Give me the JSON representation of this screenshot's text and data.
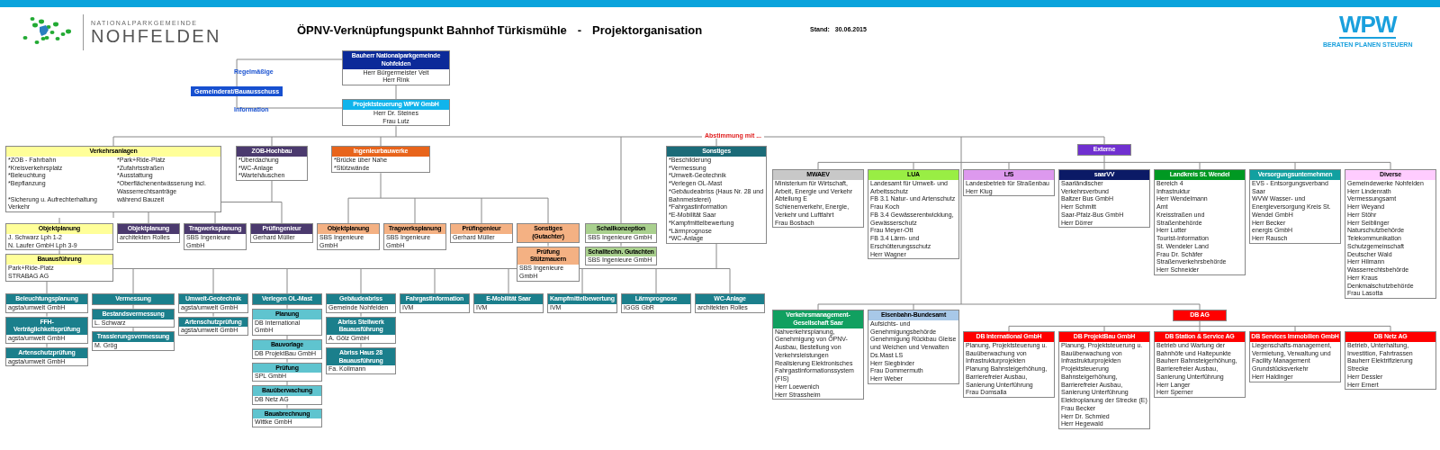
{
  "header": {
    "logo_top": "NATIONALPARKGEMEINDE",
    "logo_name": "NOHFELDEN",
    "title": "ÖPNV-Verknüpfungspunkt Bahnhof Türkismühle",
    "separator": "-",
    "subtitle": "Projektorganisation",
    "stand_label": "Stand:",
    "stand_date": "30.06.2015",
    "wpw": "WPW",
    "wpw_tagline": "BERATEN PLANEN STEUERN"
  },
  "top": {
    "bauherr": {
      "title": "Bauherr Nationalparkgemeinde Nohfelden",
      "lines": [
        "Herr Bürgermeister Veit",
        "Herr Rink"
      ]
    },
    "projektsteuerung": {
      "title": "Projektsteuerung WPW GmbH",
      "lines": [
        "Herr Dr. Steines",
        "Frau Lutz"
      ]
    },
    "gremium": "Gemeinderat/Bauausschuss",
    "info_top": "Regelmäßige",
    "info_bottom": "Information"
  },
  "abstimmung": "Abstimmung mit ...",
  "nodes": [
    {
      "title": "Verkehrsanlagen",
      "color": "#ffff99",
      "lines": [
        "*ZOB - Fahrbahn",
        "*Park+Ride-Platz",
        "*Kreisverkehrsplatz",
        "*Zufahrtsstraßen",
        "*Beleuchtung",
        "*Ausstattung",
        "*Bepflanzung",
        "*Oberflächenentwässerung incl. Wasserrechtsanträge",
        "*Sicherung u. Aufrechterhaltung Verkehr",
        "während Bauzeit"
      ]
    },
    {
      "title": "ZOB-Hochbau",
      "color": "#4b3a6e",
      "lines": [
        "*Überdachung",
        "*WC-Anlage",
        "*Wartehäuschen"
      ]
    },
    {
      "title": "Ingenieurbauwerke",
      "color": "#e8641b",
      "lines": [
        "*Brücke über Nahe",
        "*Stützwände"
      ]
    },
    {
      "title": "Sonstiges",
      "color": "#1b6b78",
      "lines": [
        "*Beschilderung",
        "*Vermessung",
        "*Umwelt-Geotechnik",
        "*Verlegen OL-Mast",
        "*Gebäudeabriss (Haus Nr. 28 und Bahnmeisterei)",
        "*Fahrgastinformation",
        "*E-Mobilität Saar",
        "*Kampfmittelbewertung",
        "*Lärmprognose",
        "*WC-Anlage"
      ]
    },
    {
      "title": "Objektplanung",
      "color": "#ffff99",
      "lines": [
        "J. Schwarz Lph 1-2",
        "N. Laufer GmbH Lph 3-9"
      ]
    },
    {
      "title": "Bauausführung",
      "color": "#ffff99",
      "lines": [
        "Park+Ride-Platz",
        "STRABAG AG"
      ]
    },
    {
      "title": "Objektplanung",
      "color": "#4b3a6e",
      "lines": [
        "architekten Rolles"
      ]
    },
    {
      "title": "Tragwerksplanung",
      "color": "#4b3a6e",
      "lines": [
        "SBS Ingenieure GmbH"
      ]
    },
    {
      "title": "Prüfingenieur",
      "color": "#4b3a6e",
      "lines": [
        "Gerhard Müller"
      ]
    },
    {
      "title": "Objektplanung",
      "color": "#f4b183",
      "lines": [
        "SBS Ingenieure GmbH"
      ]
    },
    {
      "title": "Tragwerksplanung",
      "color": "#f4b183",
      "lines": [
        "SBS Ingenieure GmbH"
      ]
    },
    {
      "title": "Prüfingenieur",
      "color": "#f4b183",
      "lines": [
        "Gerhard Müller"
      ]
    },
    {
      "title": "Sonstiges (Gutachter)",
      "color": "#f4b183"
    },
    {
      "title": "Prüfung Stützmauern",
      "color": "#f4b183",
      "lines": [
        "SBS Ingenieure GmbH"
      ]
    },
    {
      "title": "Schallkonzeption",
      "color": "#a9d08e",
      "lines": [
        "SBS Ingenieure GmbH"
      ]
    },
    {
      "title": "Schalltechn. Gutachten",
      "color": "#a9d08e",
      "lines": [
        "SBS Ingenieure GmbH"
      ]
    },
    {
      "title": "Beleuchtungsplanung",
      "color": "#1b7f8c",
      "lines": [
        "agsta/umwelt GmbH"
      ]
    },
    {
      "title": "Vermessung",
      "color": "#1b7f8c"
    },
    {
      "title": "Umwelt-Geotechnik",
      "color": "#1b7f8c",
      "lines": [
        "agsta/umwelt GmbH"
      ]
    },
    {
      "title": "Verlegen OL-Mast",
      "color": "#1b7f8c"
    },
    {
      "title": "Gebäudeabriss",
      "color": "#1b7f8c",
      "lines": [
        "Gemeinde Nohfelden"
      ]
    },
    {
      "title": "Fahrgastinformation",
      "color": "#1b7f8c",
      "lines": [
        "IVM"
      ]
    },
    {
      "title": "E-Mobilität Saar",
      "color": "#1b7f8c",
      "lines": [
        "IVM"
      ]
    },
    {
      "title": "Kampfmittelbewertung",
      "color": "#1b7f8c",
      "lines": [
        "IVM"
      ]
    },
    {
      "title": "Lärmprognose",
      "color": "#1b7f8c",
      "lines": [
        "IGGS GbR"
      ]
    },
    {
      "title": "WC-Anlage",
      "color": "#1b7f8c",
      "lines": [
        "architekten Rolles"
      ]
    },
    {
      "title": "FFH-Verträglichkeitsprüfung",
      "color": "#1b7f8c",
      "lines": [
        "agsta/umwelt GmbH"
      ]
    },
    {
      "title": "Artenschutzprüfung",
      "color": "#1b7f8c",
      "lines": [
        "agsta/umwelt GmbH"
      ]
    },
    {
      "title": "Bestandsvermessung",
      "color": "#1b7f8c",
      "lines": [
        "L. Schwarz"
      ]
    },
    {
      "title": "Trassierungsvermessung",
      "color": "#1b7f8c",
      "lines": [
        "M. Grög"
      ]
    },
    {
      "title": "Artenschutzprüfung",
      "color": "#1b7f8c",
      "lines": [
        "agsta/umwelt GmbH"
      ]
    },
    {
      "title": "Planung",
      "color": "#5fc4cf",
      "lines": [
        "DB International GmbH"
      ]
    },
    {
      "title": "Bauvorlage",
      "color": "#5fc4cf",
      "lines": [
        "DB ProjektBau GmbH"
      ]
    },
    {
      "title": "Prüfung",
      "color": "#5fc4cf",
      "lines": [
        "SPL GmbH"
      ]
    },
    {
      "title": "Bauüberwachung",
      "color": "#5fc4cf",
      "lines": [
        "DB Netz AG"
      ]
    },
    {
      "title": "Bauabrechnung",
      "color": "#5fc4cf",
      "lines": [
        "Wittke GmbH"
      ]
    },
    {
      "title": "Abriss Stellwerk Bauausführung",
      "color": "#1b7f8c",
      "lines": [
        "A. Gölz GmbH"
      ]
    },
    {
      "title": "Abriss Haus 28 Bauausführung",
      "color": "#1b7f8c",
      "lines": [
        "Fa. Kollmann"
      ]
    },
    {
      "title": "Externe",
      "color": "#7030d0"
    },
    {
      "title": "DB AG",
      "color": "#ff0000"
    },
    {
      "title": "MWAEV",
      "color": "#c8c8c8",
      "lines": [
        "Ministerium für Wirtschaft, Arbeit, Energie und Verkehr",
        "Abteilung E",
        "Schienenverkehr, Energie, Verkehr und Luftfahrt",
        "Frau Bosbach"
      ]
    },
    {
      "title": "LUA",
      "color": "#99ee44",
      "lines": [
        "Landesamt für Umwelt- und Arbeitsschutz",
        "FB 3.1 Natur- und Artenschutz",
        "Frau Koch",
        "FB 3.4 Gewässerentwicklung, Gewässerschutz",
        "Frau Meyer-Ott",
        "FB 3.4 Lärm- und Erschütterungsschutz",
        "Herr Wagner"
      ]
    },
    {
      "title": "LfS",
      "color": "#dd99ee",
      "lines": [
        "Landesbetrieb für Straßenbau",
        "Herr Klug"
      ]
    },
    {
      "title": "saarVV",
      "color": "#0b1a66",
      "lines": [
        "Saarländischer Verkehrsverbund",
        "Baltzer Bus GmbH",
        "Herr Schmitt",
        "Saar-Pfalz-Bus GmbH",
        "Herr Dörrer"
      ]
    },
    {
      "title": "Landkreis St. Wendel",
      "color": "#009922",
      "lines": [
        "Bereich 4",
        "Infrastruktur",
        "Herr Wendelmann",
        "Amt",
        "Kreisstraßen und Straßenbehörde",
        "Herr Lutter",
        "Tourist-Information",
        "St. Wendeler Land",
        "Frau Dr. Schäfer",
        "Straßenverkehrsbehörde",
        "Herr Schneider"
      ]
    },
    {
      "title": "Versorgungsunternehmen",
      "color": "#11a0a0",
      "lines": [
        "EVS - Entsorgungsverband Saar",
        "WVW Wasser- und Energieversorgung Kreis St. Wendel GmbH",
        "Herr Becker",
        "energis GmbH",
        "Herr Rausch"
      ]
    },
    {
      "title": "Diverse",
      "color": "#ffccff",
      "lines": [
        "Gemeindewerke Nohfelden",
        "Herr Lindenrath",
        "Vermessungsamt",
        "Herr Weyand",
        "Herr Stöhr",
        "Herr Seiblinger",
        "Naturschutzbehörde",
        "Telekommunikation",
        "Schutzgemeinschaft",
        "Deutscher Wald",
        "Herr Hilmann",
        "Wasserrechtsbehörde",
        "Herr Kraus",
        "Denkmalschutzbehörde",
        "Frau Lasotta"
      ]
    },
    {
      "title": "Verkehrsmanagement-Gesellschaft Saar",
      "color": "#11a060",
      "lines": [
        "Nahverkehrsplanung, Genehmigung von ÖPNV-Ausbau, Bestellung von Verkehrsleistungen",
        "Realisierung Elektronisches Fahrgastinformationssystem (FIS)",
        "Herr Loewenich",
        "Herr Strassheim"
      ]
    },
    {
      "title": "Eisenbahn-Bundesamt",
      "color": "#a8c8e8",
      "lines": [
        "Aufsichts- und Genehmigungsbehörde",
        "Genehmigung Rückbau Gleise und Weichen und Verwalten Ds.Mast LS",
        "Herr Siegbinder",
        "Frau Dommermuth",
        "Herr Weber"
      ]
    },
    {
      "title": "DB International GmbH",
      "color": "#ff0000",
      "lines": [
        "Planung, Projektsteuerung u. Bauüberwachung von Infrastrukturprojekten",
        "Planung Bahnsteigerhöhung, Barrierefreier Ausbau, Sanierung Unterführung",
        "Frau Domsalla"
      ]
    },
    {
      "title": "DB ProjektBau GmbH",
      "color": "#ff0000",
      "lines": [
        "Planung, Projektsteuerung u. Bauüberwachung von Infrastrukturprojekten",
        "Projektsteuerung Bahnsteigerhöhung, Barrierefreier Ausbau, Sanierung Unterführung",
        "Elektroplanung der Strecke (E)",
        "Frau Becker",
        "Herr Dr. Schmied",
        "Herr Hegewald"
      ]
    },
    {
      "title": "DB Station & Service AG",
      "color": "#ff0000",
      "lines": [
        "Betrieb und Wartung der Bahnhöfe und Haltepunkte",
        "Bauherr Bahnsteigerhöhung, Barrierefreier Ausbau, Sanierung Unterführung",
        "Herr Langer",
        "Herr Sperner"
      ]
    },
    {
      "title": "DB Services Immobilien GmbH",
      "color": "#ff0000",
      "lines": [
        "Liegenschafts-management, Vermietung, Verwaltung und Facility Management",
        "Grundstücksverkehr",
        "Herr Haldinger"
      ]
    },
    {
      "title": "DB Netz AG",
      "color": "#ff0000",
      "lines": [
        "Betrieb, Unterhaltung, Investition, Fahrtrassen",
        "Bauherr Elektrifizierung Strecke",
        "Herr Dessler",
        "Herr Ernert"
      ]
    }
  ]
}
